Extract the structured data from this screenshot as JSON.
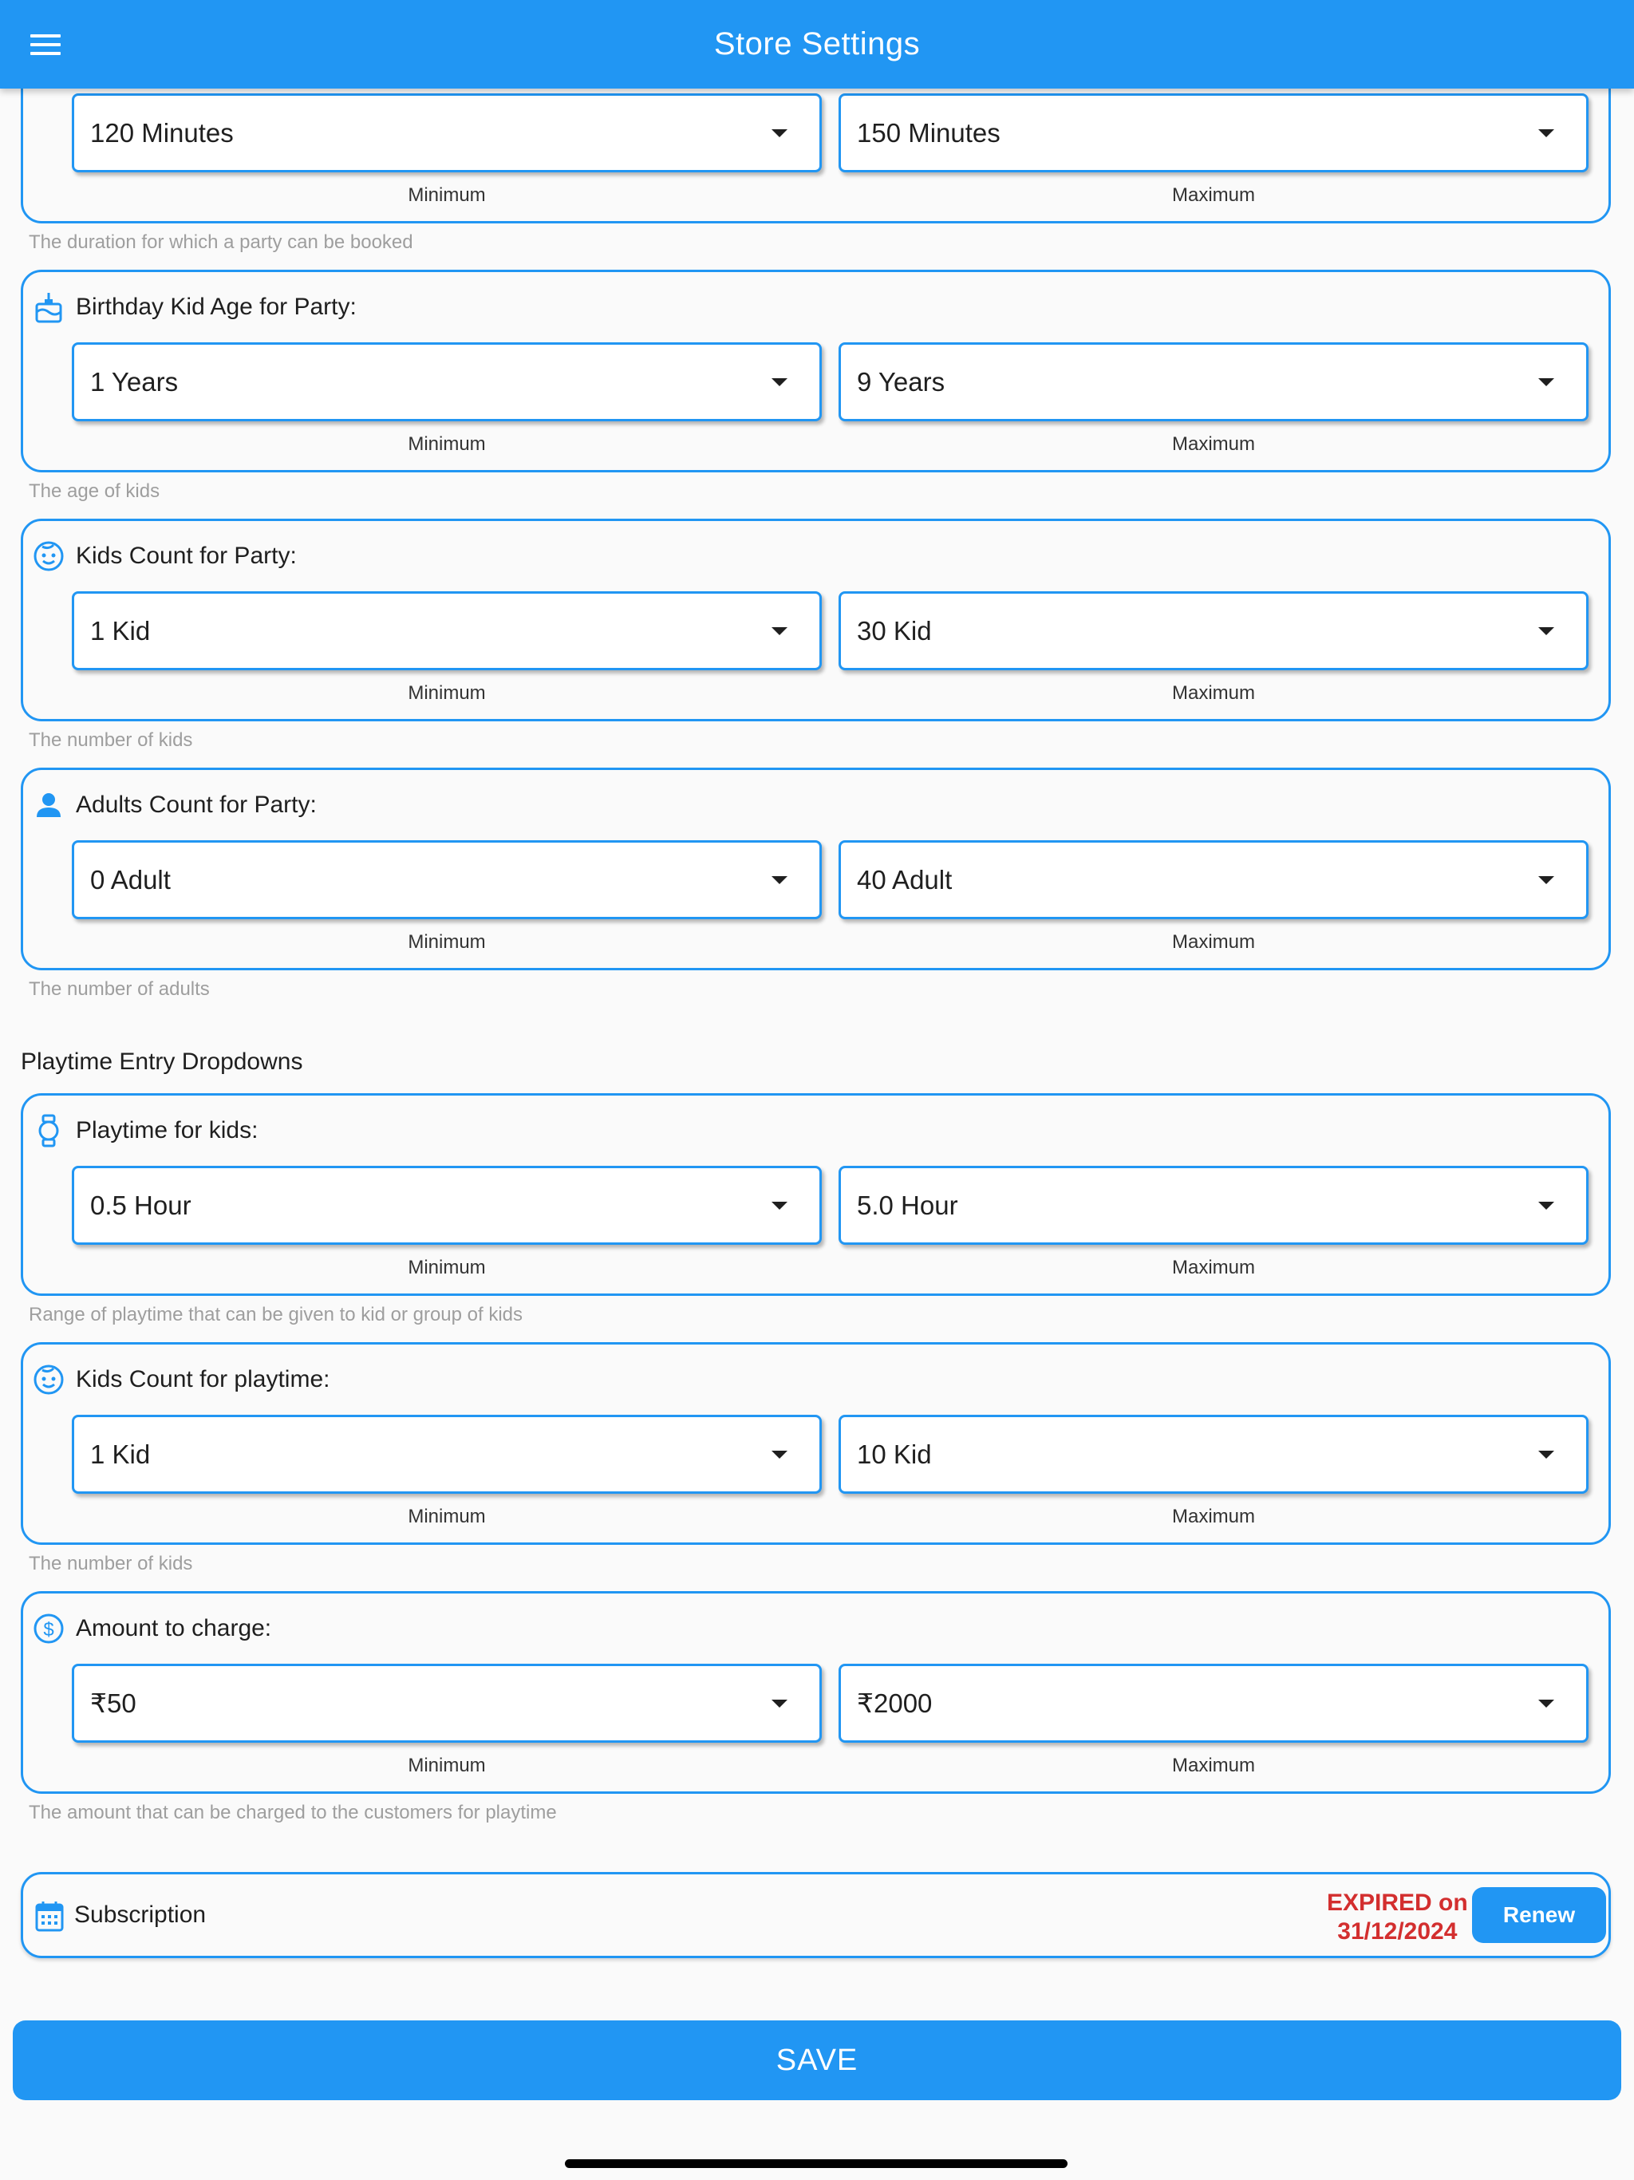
{
  "app_bar": {
    "title": "Store Settings",
    "menu_icon": "menu-icon"
  },
  "party_cards": [
    {
      "id": "party-duration",
      "title": "",
      "icon": "",
      "min_value": "120 Minutes",
      "max_value": "150 Minutes",
      "min_caption": "Minimum",
      "max_caption": "Maximum",
      "helper": "The duration for which a party can be booked"
    },
    {
      "id": "birthday-kid-age",
      "title": "Birthday Kid Age for Party:",
      "icon": "cake-icon",
      "min_value": "1 Years",
      "max_value": "9 Years",
      "min_caption": "Minimum",
      "max_caption": "Maximum",
      "helper": "The age of kids"
    },
    {
      "id": "kids-count-party",
      "title": "Kids Count for Party:",
      "icon": "child-face-icon",
      "min_value": "1 Kid",
      "max_value": "30 Kid",
      "min_caption": "Minimum",
      "max_caption": "Maximum",
      "helper": "The number of kids"
    },
    {
      "id": "adults-count-party",
      "title": "Adults Count for Party:",
      "icon": "person-icon",
      "min_value": "0 Adult",
      "max_value": "40 Adult",
      "min_caption": "Minimum",
      "max_caption": "Maximum",
      "helper": "The number of adults"
    }
  ],
  "playtime_section_title": "Playtime Entry Dropdowns",
  "playtime_cards": [
    {
      "id": "playtime-for-kids",
      "title": "Playtime for kids:",
      "icon": "watch-icon",
      "min_value": "0.5 Hour",
      "max_value": "5.0 Hour",
      "min_caption": "Minimum",
      "max_caption": "Maximum",
      "helper": "Range of playtime that can be given to kid or group of kids"
    },
    {
      "id": "kids-count-playtime",
      "title": "Kids Count for playtime:",
      "icon": "child-face-icon",
      "min_value": "1 Kid",
      "max_value": "10 Kid",
      "min_caption": "Minimum",
      "max_caption": "Maximum",
      "helper": "The number of kids"
    },
    {
      "id": "amount-to-charge",
      "title": "Amount to charge:",
      "icon": "dollar-circle-icon",
      "min_value": "₹50",
      "max_value": "₹2000",
      "min_caption": "Minimum",
      "max_caption": "Maximum",
      "helper": "The amount that can be charged to the customers for playtime"
    }
  ],
  "subscription": {
    "label": "Subscription",
    "icon": "calendar-icon",
    "status_line1": "EXPIRED on",
    "status_line2": "31/12/2024",
    "renew_label": "Renew"
  },
  "save_label": "SAVE",
  "colors": {
    "primary": "#2196f3",
    "expired": "#d32f2f",
    "helper_text": "#9e9e9e"
  }
}
